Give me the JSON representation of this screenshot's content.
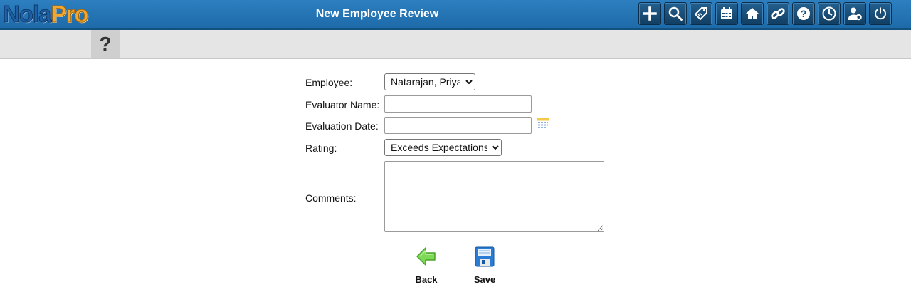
{
  "header": {
    "logo_part1": "Nola",
    "logo_part2": "Pro",
    "title": "New Employee Review",
    "icons": [
      "plus-icon",
      "search-icon",
      "tag-icon",
      "calendar-icon",
      "home-icon",
      "link-icon",
      "help-icon",
      "clock-icon",
      "user-settings-icon",
      "power-icon"
    ]
  },
  "subbar": {
    "help_symbol": "?"
  },
  "form": {
    "employee_label": "Employee:",
    "employee_value": "Natarajan, Priya",
    "evaluator_label": "Evaluator Name:",
    "evaluator_value": "",
    "date_label": "Evaluation Date:",
    "date_value": "",
    "rating_label": "Rating:",
    "rating_value": "Exceeds Expectations",
    "comments_label": "Comments:",
    "comments_value": ""
  },
  "actions": {
    "back_label": "Back",
    "save_label": "Save"
  },
  "colors": {
    "topbar": "#1f6fae",
    "subbar": "#e5e5e5",
    "back_arrow": "#7ed957",
    "save_disk": "#2a7bd4"
  }
}
